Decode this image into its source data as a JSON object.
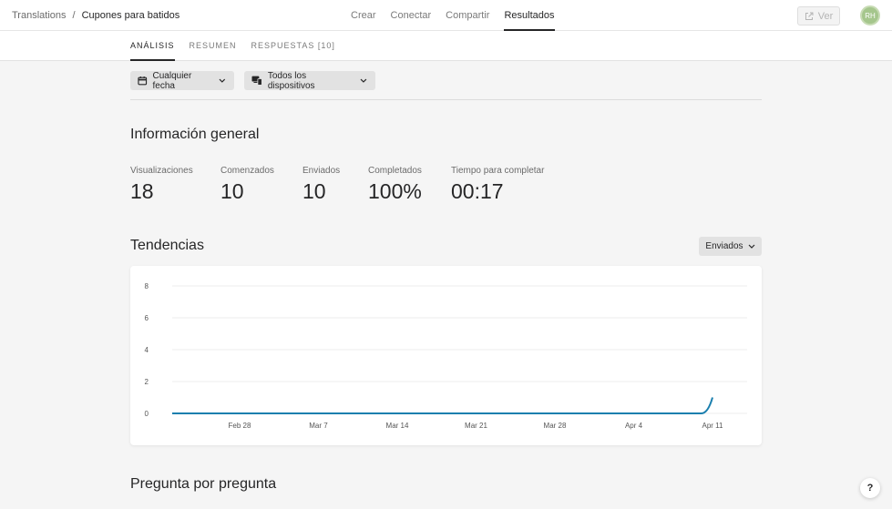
{
  "breadcrumb": {
    "root": "Translations",
    "separator": "/",
    "current": "Cupones para batidos"
  },
  "topnav": [
    {
      "label": "Crear",
      "active": false
    },
    {
      "label": "Conectar",
      "active": false
    },
    {
      "label": "Compartir",
      "active": false
    },
    {
      "label": "Resultados",
      "active": true
    }
  ],
  "ver_button": {
    "label": "Ver",
    "icon": "external-link-icon"
  },
  "avatar": {
    "initials": "RH",
    "color": "#a5c68c"
  },
  "subtabs": [
    {
      "label": "ANÁLISIS",
      "active": true
    },
    {
      "label": "RESUMEN",
      "active": false
    },
    {
      "label": "RESPUESTAS [10]",
      "active": false
    }
  ],
  "filters": {
    "date": {
      "label": "Cualquier fecha",
      "icon": "calendar-icon"
    },
    "device": {
      "label": "Todos los dispositivos",
      "icon": "devices-icon"
    }
  },
  "overview": {
    "title": "Información general",
    "stats": [
      {
        "label": "Visualizaciones",
        "value": "18"
      },
      {
        "label": "Comenzados",
        "value": "10"
      },
      {
        "label": "Enviados",
        "value": "10"
      },
      {
        "label": "Completados",
        "value": "100%"
      },
      {
        "label": "Tiempo para completar",
        "value": "00:17"
      }
    ]
  },
  "trends": {
    "title": "Tendencias",
    "series_select": "Enviados"
  },
  "chart_data": {
    "type": "line",
    "line_color": "#1a7fae",
    "x_ticks": [
      "Feb 28",
      "Mar 7",
      "Mar 14",
      "Mar 21",
      "Mar 28",
      "Apr 4",
      "Apr 11"
    ],
    "y_ticks": [
      0,
      2,
      4,
      6,
      8
    ],
    "ylim": [
      0,
      8
    ],
    "grid": true,
    "series": [
      {
        "points": [
          [
            "Feb 21",
            0
          ],
          [
            "Feb 28",
            0
          ],
          [
            "Mar 7",
            0
          ],
          [
            "Mar 14",
            0
          ],
          [
            "Mar 21",
            0
          ],
          [
            "Mar 28",
            0
          ],
          [
            "Apr 4",
            0
          ],
          [
            "Apr 10",
            0
          ],
          [
            "Apr 11",
            1
          ]
        ]
      }
    ]
  },
  "question_section": {
    "title": "Pregunta por pregunta"
  },
  "help": {
    "label": "?"
  }
}
